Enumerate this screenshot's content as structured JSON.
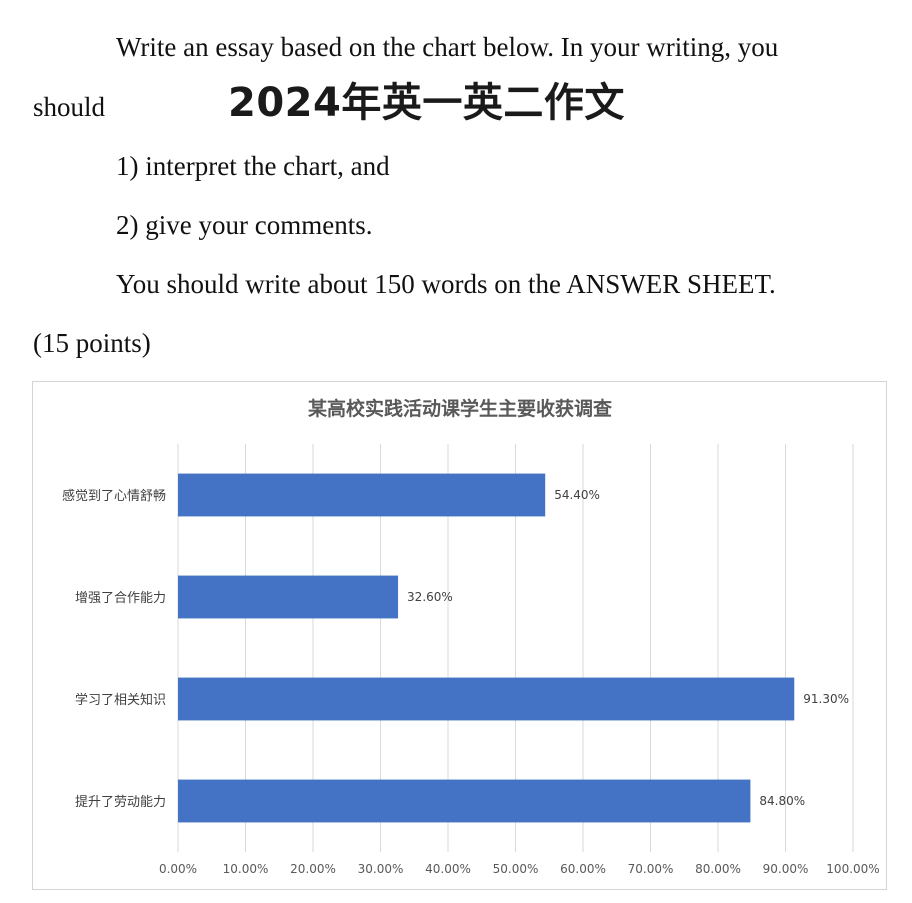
{
  "prompt": {
    "line1": "Write an essay based on the chart below. In your writing, you",
    "line2": "should",
    "watermark": "2024年英一英二作文",
    "line3": "1) interpret the chart, and",
    "line4": "2) give your comments.",
    "line5": "You should write about 150 words on the ANSWER SHEET.",
    "line6": "(15 points)"
  },
  "chart_data": {
    "type": "bar",
    "orientation": "horizontal",
    "title": "某高校实践活动课学生主要收获调查",
    "categories": [
      "感觉到了心情舒畅",
      "增强了合作能力",
      "学习了相关知识",
      "提升了劳动能力"
    ],
    "values": [
      54.4,
      32.6,
      91.3,
      84.8
    ],
    "data_labels": [
      "54.40%",
      "32.60%",
      "91.30%",
      "84.80%"
    ],
    "xlim": [
      0,
      100
    ],
    "x_ticks": [
      "0.00%",
      "10.00%",
      "20.00%",
      "30.00%",
      "40.00%",
      "50.00%",
      "60.00%",
      "70.00%",
      "80.00%",
      "90.00%",
      "100.00%"
    ],
    "grid": "vertical",
    "legend": "none",
    "bar_color": "#4472C4"
  }
}
